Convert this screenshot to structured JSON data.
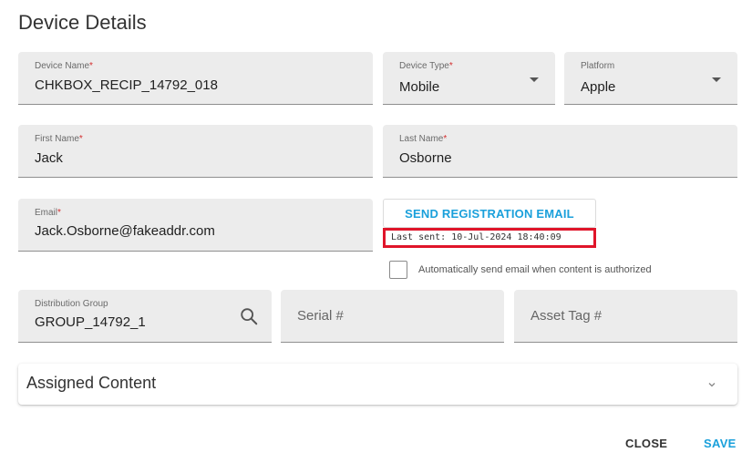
{
  "dialog": {
    "title": "Device Details"
  },
  "fields": {
    "device_name": {
      "label": "Device Name",
      "required_mark": "*",
      "value": "CHKBOX_RECIP_14792_018"
    },
    "device_type": {
      "label": "Device Type",
      "required_mark": "*",
      "value": "Mobile"
    },
    "platform": {
      "label": "Platform",
      "value": "Apple"
    },
    "first_name": {
      "label": "First Name",
      "required_mark": "*",
      "value": "Jack"
    },
    "last_name": {
      "label": "Last Name",
      "required_mark": "*",
      "value": "Osborne"
    },
    "email": {
      "label": "Email",
      "required_mark": "*",
      "value": "Jack.Osborne@fakeaddr.com"
    },
    "distribution_group": {
      "label": "Distribution Group",
      "value": "GROUP_14792_1"
    },
    "serial": {
      "placeholder": "Serial #"
    },
    "asset_tag": {
      "placeholder": "Asset Tag #"
    }
  },
  "registration": {
    "button_label": "SEND REGISTRATION EMAIL",
    "last_sent": "Last sent: 10-Jul-2024 18:40:09",
    "auto_send_label": "Automatically send email when content is authorized",
    "auto_send_checked": false
  },
  "assigned_content": {
    "label": "Assigned Content"
  },
  "footer": {
    "close_label": "CLOSE",
    "save_label": "SAVE"
  },
  "colors": {
    "accent": "#1aa0db",
    "required": "#d32f2f",
    "highlight_border": "#e0152a",
    "field_bg": "#ececec"
  },
  "icons": {
    "dropdown": "caret-down-icon",
    "search": "search-icon",
    "expand": "chevron-down-icon"
  }
}
